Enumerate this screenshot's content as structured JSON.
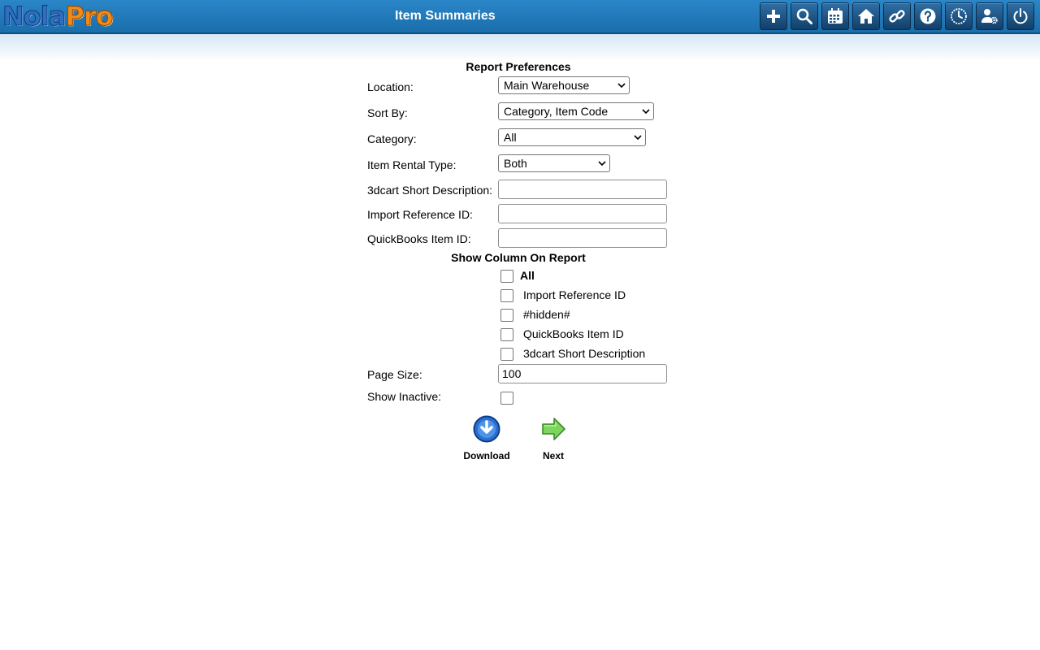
{
  "header": {
    "logo_part1": "Nola",
    "logo_part2": "Pro",
    "title": "Item Summaries",
    "toolbar": [
      "add-icon",
      "search-icon",
      "calendar-icon",
      "home-icon",
      "link-icon",
      "help-icon",
      "clock-icon",
      "user-settings-icon",
      "power-icon"
    ]
  },
  "form": {
    "section_title": "Report Preferences",
    "location": {
      "label": "Location:",
      "value": "Main Warehouse"
    },
    "sort_by": {
      "label": "Sort By:",
      "value": "Category, Item Code"
    },
    "category": {
      "label": "Category:",
      "value": "All"
    },
    "rental_type": {
      "label": "Item Rental Type:",
      "value": "Both"
    },
    "short_desc": {
      "label": "3dcart Short Description:",
      "value": ""
    },
    "import_ref": {
      "label": "Import Reference ID:",
      "value": ""
    },
    "qb_item": {
      "label": "QuickBooks Item ID:",
      "value": ""
    },
    "columns_title": "Show Column On Report",
    "columns": {
      "all": "All",
      "import_ref": "Import Reference ID",
      "hidden": "#hidden#",
      "qb_item": "QuickBooks Item ID",
      "short_desc": "3dcart Short Description"
    },
    "page_size": {
      "label": "Page Size:",
      "value": "100"
    },
    "show_inactive": {
      "label": "Show Inactive:"
    }
  },
  "actions": {
    "download": "Download",
    "next": "Next"
  },
  "colors": {
    "header": "#1f78bb",
    "accent_orange": "#f08a18"
  }
}
